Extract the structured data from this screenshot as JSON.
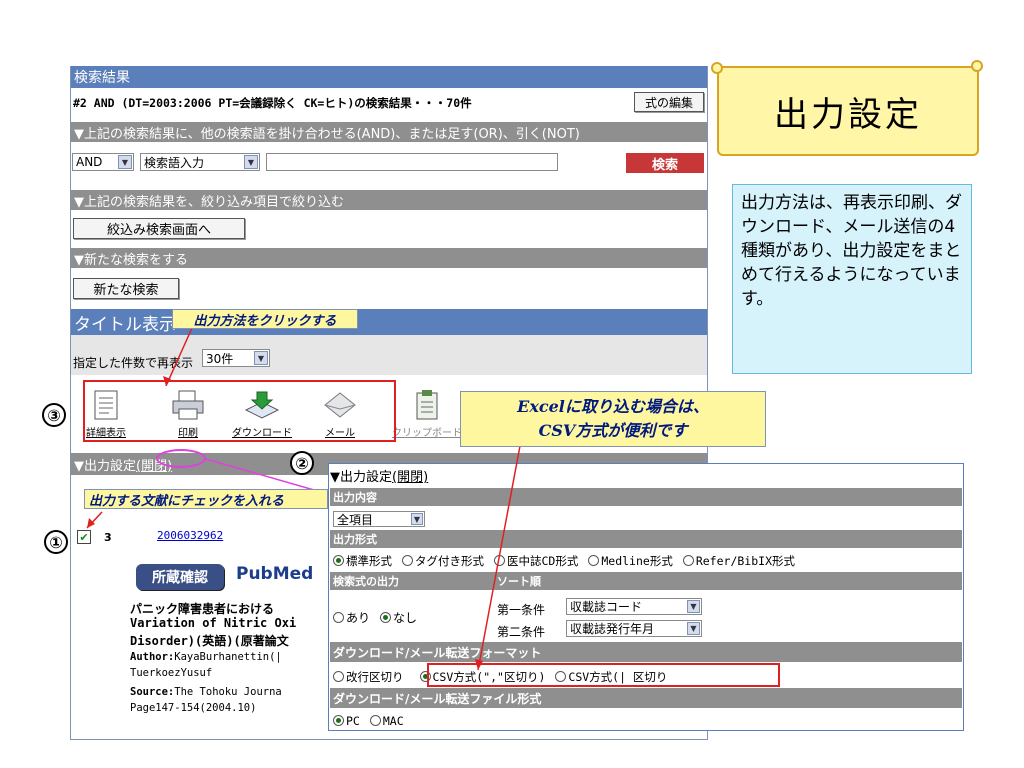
{
  "search": {
    "header": "検索結果",
    "query": "#2 AND (DT=2003:2006 PT=会議録除く CK=ヒト)の検索結果・・・70件",
    "edit_button": "式の編集",
    "combine_bar": "▼上記の検索結果に、他の検索語を掛け合わせる(AND)、または足す(OR)、引く(NOT)",
    "operator": "AND",
    "field": "検索語入力",
    "term_value": "",
    "search_button": "検索",
    "filter_bar": "▼上記の検索結果を、絞り込み項目で絞り込む",
    "filter_button": "絞込み検索画面へ",
    "new_bar": "▼新たな検索をする",
    "new_button": "新たな検索"
  },
  "title_display": {
    "header": "タイトル表示",
    "redisplay_label": "指定した件数で再表示",
    "count_select": "30件"
  },
  "tools": [
    {
      "label": "詳細表示",
      "icon": "document-icon"
    },
    {
      "label": "印刷",
      "icon": "printer-icon"
    },
    {
      "label": "ダウンロード",
      "icon": "download-icon"
    },
    {
      "label": "メール",
      "icon": "mail-icon"
    },
    {
      "label": "クリップボード",
      "icon": "clipboard-icon"
    }
  ],
  "output_toggle": {
    "label": "▼出力設定",
    "link": "(開閉)"
  },
  "record": {
    "number": "3",
    "id": "2006032962",
    "holdings_button": "所蔵確認",
    "pubmed_logo": "PubMed",
    "title_ja": "パニック障害患者における",
    "title_en1": "Variation of Nitric Oxi",
    "title_en2": "Disorder)(英語)(原著論文",
    "author_label": "Author:",
    "author_value": "KayaBurhanettin(|",
    "author_line2": "TuerkoezYusuf",
    "source_label": "Source:",
    "source_value": "The Tohoku Journa",
    "page_line": "Page147-154(2004.10)"
  },
  "output_panel": {
    "title": "▼出力設定",
    "link": "(開閉)",
    "content_header": "出力内容",
    "content_select": "全項目",
    "format_header": "出力形式",
    "formats": [
      {
        "label": "標準形式",
        "selected": true
      },
      {
        "label": "タグ付き形式",
        "selected": false
      },
      {
        "label": "医中誌CD形式",
        "selected": false
      },
      {
        "label": "Medline形式",
        "selected": false
      },
      {
        "label": "Refer/BibIX形式",
        "selected": false
      }
    ],
    "expr_header": "検索式の出力",
    "sort_header": "ソート順",
    "expr_options": [
      {
        "label": "あり",
        "selected": false
      },
      {
        "label": "なし",
        "selected": true
      }
    ],
    "sort1_label": "第一条件",
    "sort1_value": "収載誌コード",
    "sort2_label": "第二条件",
    "sort2_value": "収載誌発行年月",
    "dl_format_header": "ダウンロード/メール転送フォーマット",
    "dl_formats": [
      {
        "label": "改行区切り",
        "selected": false
      },
      {
        "label": "CSV方式(\",\"区切り)",
        "selected": true
      },
      {
        "label": "CSV方式(| 区切り",
        "selected": false
      }
    ],
    "file_header": "ダウンロード/メール転送ファイル形式",
    "file_options": [
      {
        "label": "PC",
        "selected": true
      },
      {
        "label": "MAC",
        "selected": false
      }
    ]
  },
  "annotations": {
    "scroll_title": "出力設定",
    "note_text": "出力方法は、再表示印刷、ダウンロード、メール送信の4種類があり、出力設定をまとめて行えるようになっています。",
    "callout_click": "出力方法をクリックする",
    "callout_excel_1": "Excelに取り込む場合は、",
    "callout_excel_2": "CSV方式が便利です",
    "callout_check": "出力する文献にチェックを入れる",
    "marker_1": "①",
    "marker_2": "②",
    "marker_3": "③"
  },
  "colors": {
    "header_blue": "#5b7fba",
    "bar_gray": "#8f8f8f",
    "search_red": "#c83737",
    "callout_yellow": "#fff7a0",
    "highlight_red": "#e02020",
    "magenta": "#e040e0"
  }
}
